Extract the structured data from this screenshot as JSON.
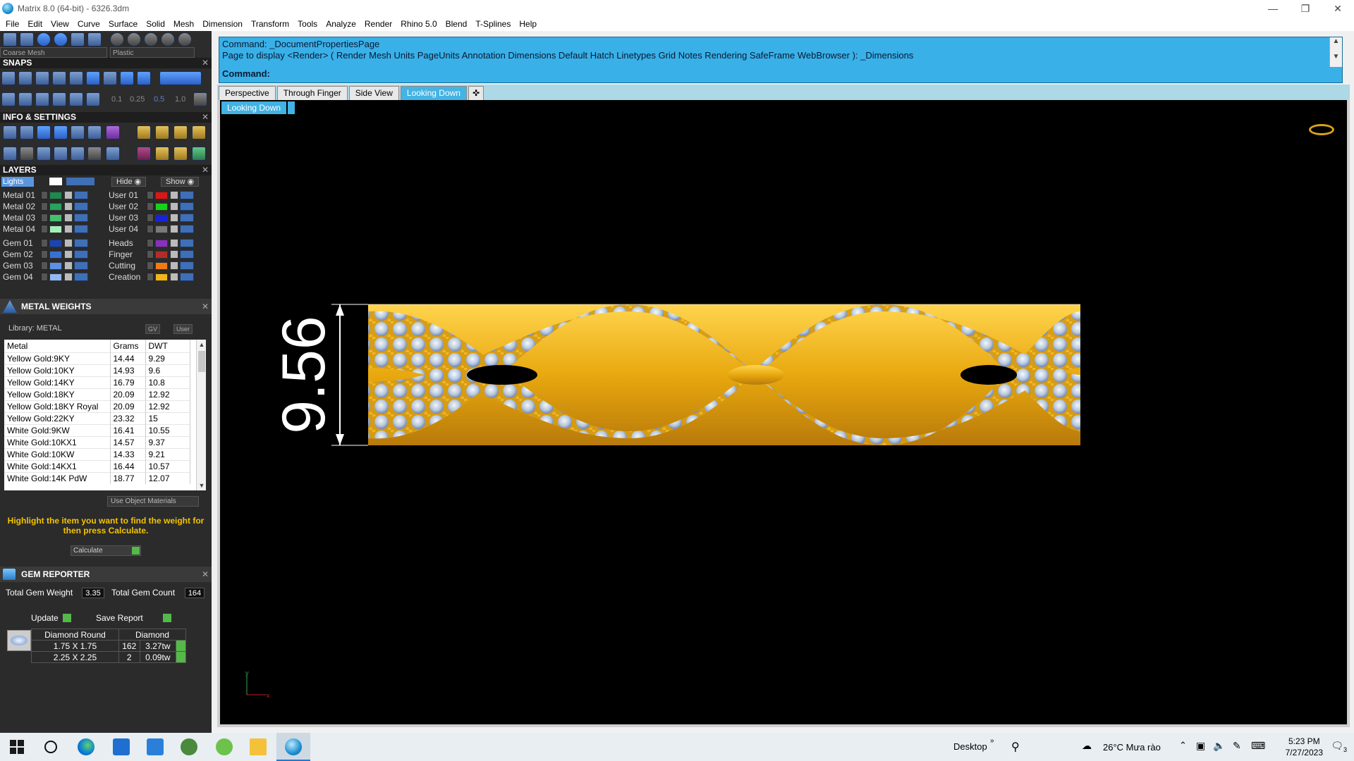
{
  "window": {
    "title": "Matrix 8.0 (64-bit) - 6326.3dm"
  },
  "menu": [
    "File",
    "Edit",
    "View",
    "Curve",
    "Surface",
    "Solid",
    "Mesh",
    "Dimension",
    "Transform",
    "Tools",
    "Analyze",
    "Render",
    "Rhino 5.0",
    "Blend",
    "T-Splines",
    "Help"
  ],
  "top_dropdowns": {
    "mesh": "Coarse Mesh",
    "material": "Plastic"
  },
  "snaps": {
    "title": "SNAPS",
    "grid_values": [
      "0.1",
      "0.25",
      "0.5",
      "1.0"
    ]
  },
  "info": {
    "title": "INFO & SETTINGS"
  },
  "layers": {
    "title": "LAYERS",
    "lights": "Lights",
    "hide": "Hide",
    "show": "Show",
    "left": [
      {
        "label": "Metal 01",
        "color": "#1d8a4e"
      },
      {
        "label": "Metal 02",
        "color": "#27a35c"
      },
      {
        "label": "Metal 03",
        "color": "#46c06f"
      },
      {
        "label": "Metal 04",
        "color": "#a5f0b9"
      },
      {
        "label": "Gem 01",
        "color": "#1844b5"
      },
      {
        "label": "Gem 02",
        "color": "#3671d6"
      },
      {
        "label": "Gem 03",
        "color": "#5b92e6"
      },
      {
        "label": "Gem 04",
        "color": "#8fb8f5"
      }
    ],
    "right": [
      {
        "label": "User 01",
        "color": "#e01414"
      },
      {
        "label": "User 02",
        "color": "#16d31a"
      },
      {
        "label": "User 03",
        "color": "#1a22d8"
      },
      {
        "label": "User 04",
        "color": "#7a7a7a"
      },
      {
        "label": "Heads",
        "color": "#8b2fc2"
      },
      {
        "label": "Finger",
        "color": "#b52b2b"
      },
      {
        "label": "Cutting",
        "color": "#f07b14"
      },
      {
        "label": "Creation",
        "color": "#f2b518"
      }
    ]
  },
  "metal_weights": {
    "title": "METAL WEIGHTS",
    "library": "Library: METAL",
    "gv": "GV",
    "user": "User",
    "columns": [
      "Metal",
      "Grams",
      "DWT"
    ],
    "rows": [
      [
        "Yellow Gold:9KY",
        "14.44",
        "9.29"
      ],
      [
        "Yellow Gold:10KY",
        "14.93",
        "9.6"
      ],
      [
        "Yellow Gold:14KY",
        "16.79",
        "10.8"
      ],
      [
        "Yellow Gold:18KY",
        "20.09",
        "12.92"
      ],
      [
        "Yellow Gold:18KY Royal",
        "20.09",
        "12.92"
      ],
      [
        "Yellow Gold:22KY",
        "23.32",
        "15"
      ],
      [
        "White Gold:9KW",
        "16.41",
        "10.55"
      ],
      [
        "White Gold:10KX1",
        "14.57",
        "9.37"
      ],
      [
        "White Gold:10KW",
        "14.33",
        "9.21"
      ],
      [
        "White Gold:14KX1",
        "16.44",
        "10.57"
      ],
      [
        "White Gold:14K PdW",
        "18.77",
        "12.07"
      ]
    ],
    "use_object_materials": "Use Object Materials",
    "hint": "Highlight the item you want to find the weight for then press Calculate.",
    "calculate": "Calculate"
  },
  "gem_reporter": {
    "title": "GEM REPORTER",
    "total_weight_label": "Total Gem Weight",
    "total_weight": "3.35",
    "total_count_label": "Total Gem Count",
    "total_count": "164",
    "update": "Update",
    "save_report": "Save Report",
    "columns": [
      "Diamond Round",
      "Diamond"
    ],
    "rows": [
      {
        "size": "1.75 X 1.75",
        "count": "162",
        "weight": "3.27tw"
      },
      {
        "size": "2.25 X 2.25",
        "count": "2",
        "weight": "0.09tw"
      }
    ]
  },
  "command": {
    "line1": "Command: _DocumentPropertiesPage",
    "line2": "Page to display <Render> ( Render  Mesh  Units  PageUnits  Annotation  Dimensions  Default  Hatch  Linetypes  Grid  Notes  Rendering  SafeFrame  WebBrowser ): _Dimensions",
    "prompt": "Command:",
    "input": ""
  },
  "viewport_tabs": [
    "Perspective",
    "Through Finger",
    "Side View",
    "Looking Down"
  ],
  "active_tab": "Looking Down",
  "viewport": {
    "label": "Looking Down",
    "dimension": "9.56",
    "axis_y": "y",
    "axis_x": "x"
  },
  "taskbar": {
    "desktop": "Desktop",
    "weather": "26°C  Mưa rào",
    "time": "5:23 PM",
    "date": "7/27/2023",
    "notifications": "3"
  }
}
